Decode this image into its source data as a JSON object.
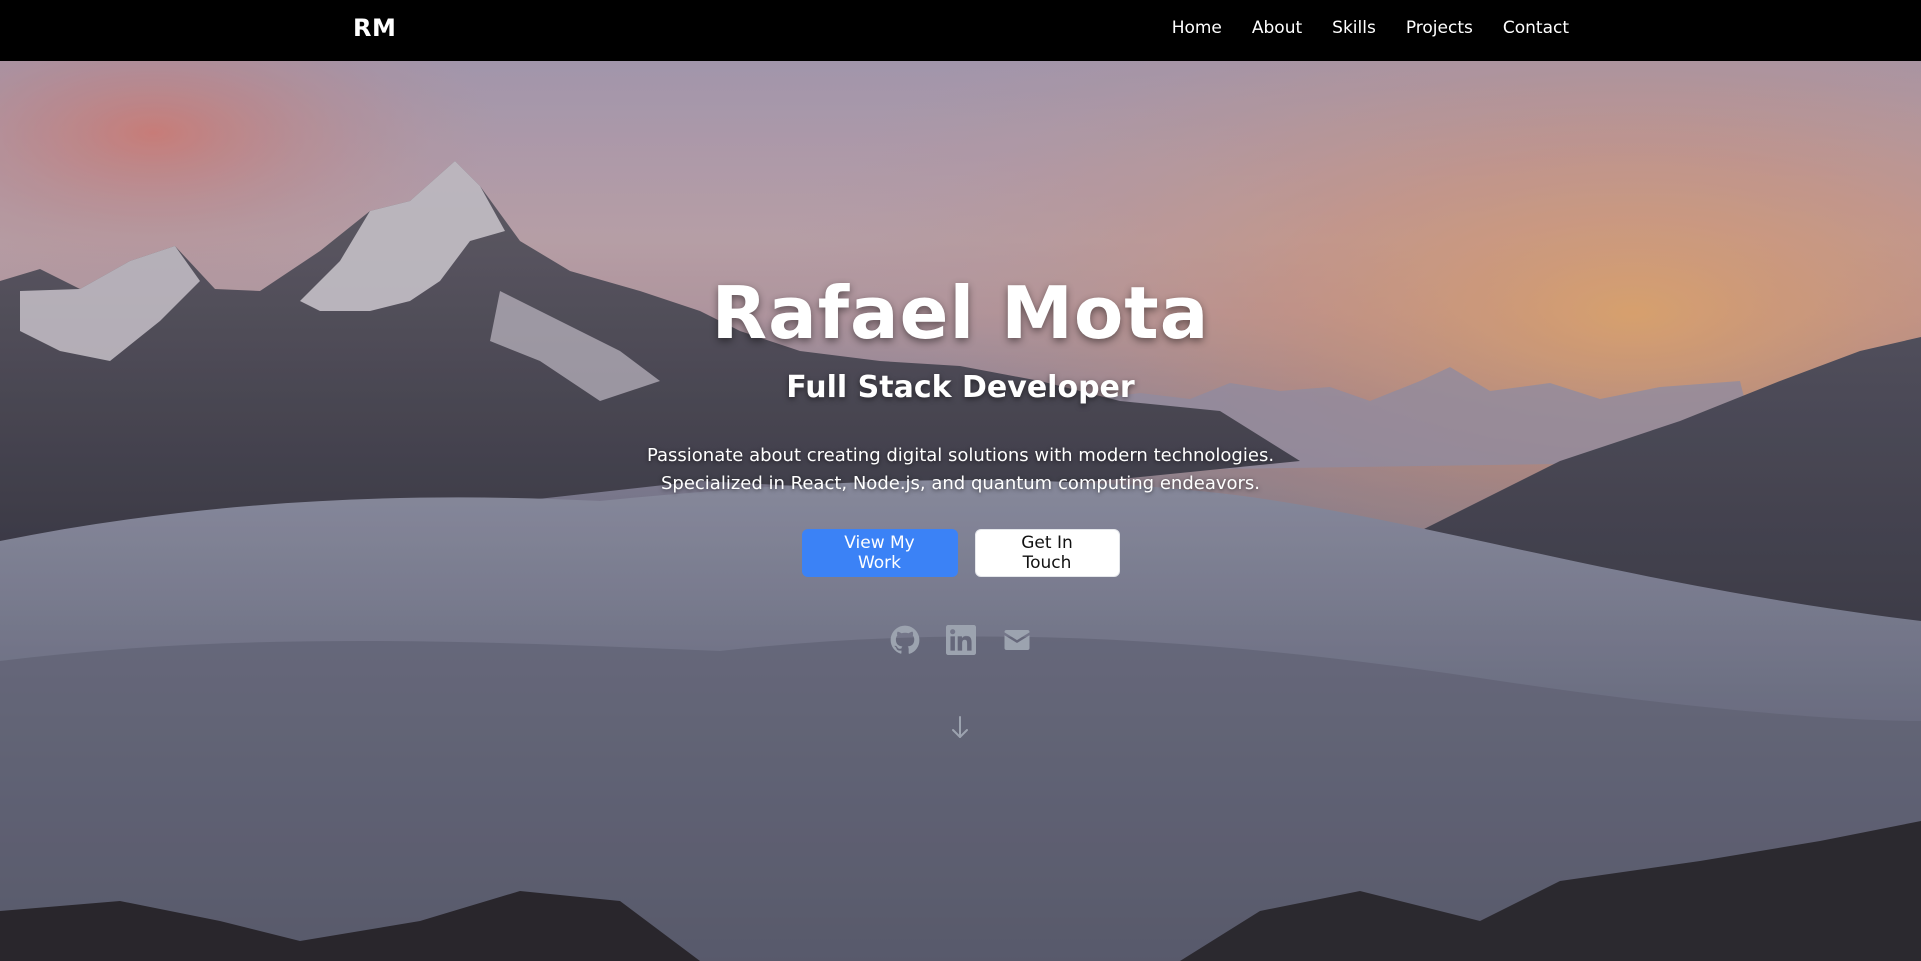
{
  "nav": {
    "brand": "RM",
    "links": [
      "Home",
      "About",
      "Skills",
      "Projects",
      "Contact"
    ]
  },
  "hero": {
    "name": "Rafael Mota",
    "role": "Full Stack Developer",
    "description_line1": "Passionate about creating digital solutions with modern technologies.",
    "description_line2": "Specialized in React, Node.js, and quantum computing endeavors.",
    "primary_button": "View My Work",
    "secondary_button": "Get In Touch"
  },
  "socials": [
    {
      "icon": "github-icon"
    },
    {
      "icon": "linkedin-icon"
    },
    {
      "icon": "mail-icon"
    }
  ],
  "scroll_icon": "arrow-down-icon",
  "colors": {
    "navbar_bg": "#000000",
    "primary_button": "#3b82f6",
    "secondary_button": "#ffffff",
    "icon_muted": "#9ca3af"
  }
}
